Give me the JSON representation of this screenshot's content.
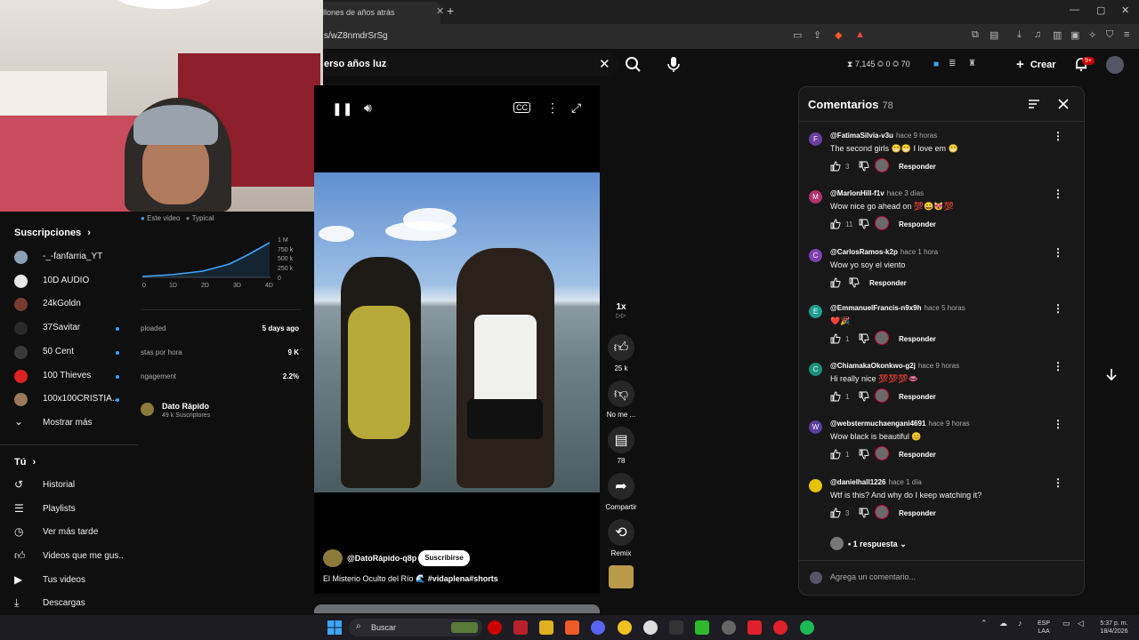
{
  "browser": {
    "tab_title": "llones de años atrás",
    "url": "s/wZ8nmdrSrSg"
  },
  "header": {
    "search_value": "erso años luz",
    "stats": "⧗ 7,145  ◎ 0  ◎ 70",
    "create_label": "Crear",
    "notifications_badge": "9+"
  },
  "sidebar": {
    "subscriptions_title": "Suscripciones",
    "subscriptions": [
      {
        "label": "-_-fanfarria_YT",
        "color": "#8aa0b5",
        "dot": false
      },
      {
        "label": "10D AUDIO",
        "color": "#e8e8e8",
        "dot": false
      },
      {
        "label": "24kGoldn",
        "color": "#7a3b30",
        "dot": false
      },
      {
        "label": "37Savitar",
        "color": "#2a2a2a",
        "dot": true
      },
      {
        "label": "50 Cent",
        "color": "#3a3a3a",
        "dot": true
      },
      {
        "label": "100 Thieves",
        "color": "#d22",
        "dot": true
      },
      {
        "label": "100x100CRISTIA...",
        "color": "#9a7a5a",
        "dot": true
      }
    ],
    "show_more": "Mostrar más",
    "you_title": "Tú",
    "you_items": [
      {
        "label": "Historial",
        "icon": "history-icon"
      },
      {
        "label": "Playlists",
        "icon": "playlists-icon"
      },
      {
        "label": "Ver más tarde",
        "icon": "clock-icon"
      },
      {
        "label": "Videos que me gus...",
        "icon": "thumbs-up-icon"
      },
      {
        "label": "Tus videos",
        "icon": "play-square-icon"
      },
      {
        "label": "Descargas",
        "icon": "download-icon"
      }
    ]
  },
  "analytics": {
    "legend_this": "Este video",
    "legend_typical": "Typical",
    "y_ticks": [
      "1 M",
      "750 k",
      "500 k",
      "250 k",
      "0"
    ],
    "x_ticks": [
      "0",
      "1D",
      "2D",
      "3D",
      "4D"
    ],
    "rows": [
      {
        "label": "ploaded",
        "value": "5 days ago"
      },
      {
        "label": "stas por hora",
        "value": "9 K"
      },
      {
        "label": "ngagement",
        "value": "2.2%"
      }
    ],
    "channel_name": "Dato Rápido",
    "channel_subs": "49 k Suscriptores"
  },
  "short": {
    "channel_handle": "@DatoRápido-q8p",
    "subscribe_label": "Suscribirse",
    "title_plain": "El Misterio Oculto del Río 🌊 ",
    "title_tags": "#vidaplena#shorts",
    "speed": "1x"
  },
  "actions": {
    "likes": "25 k",
    "dislike": "No me ...",
    "comments": "78",
    "share": "Compartir",
    "remix": "Remix"
  },
  "comments": {
    "title": "Comentarios",
    "count": "78",
    "reply_label": "Responder",
    "items": [
      {
        "initial": "F",
        "color": "#6b3fa0",
        "user": "@FatimaSilvia-v3u",
        "time": "hace 9 horas",
        "text": "The second girls 😁😁 I love em 😁",
        "likes": "3",
        "creator": true
      },
      {
        "initial": "M",
        "color": "#b0336a",
        "user": "@MarlonHill-f1v",
        "time": "hace 3 días",
        "text": "Wow nice go ahead on 💯😀😻💯",
        "likes": "11",
        "creator": true
      },
      {
        "initial": "C",
        "color": "#7e3fb0",
        "user": "@CarlosRamos-k2p",
        "time": "hace 1 hora",
        "text": "Wow  yo soy el viento",
        "likes": "",
        "creator": false
      },
      {
        "initial": "E",
        "color": "#1f9e8f",
        "user": "@EmmanuelFrancis-n9x9h",
        "time": "hace 5 horas",
        "text": "❤️🎉",
        "likes": "1",
        "creator": true
      },
      {
        "initial": "C",
        "color": "#1b8f7a",
        "user": "@ChiamakaOkonkwo-g2j",
        "time": "hace 9 horas",
        "text": "Hi really nice 💯💯💯👄",
        "likes": "1",
        "creator": true
      },
      {
        "initial": "W",
        "color": "#5a3fa0",
        "user": "@webstermuchaenganì4691",
        "time": "hace 9 horas",
        "text": "Wow black is beautiful 😊",
        "likes": "1",
        "creator": true
      },
      {
        "initial": "",
        "color": "#e6c200",
        "user": "@danielhall1226",
        "time": "hace 1 día",
        "text": "Wtf is this? And why do I keep watching it?",
        "likes": "3",
        "creator": true
      }
    ],
    "replies_label": "1 respuesta",
    "add_placeholder": "Agrega un comentario..."
  },
  "taskbar": {
    "search_label": "Buscar",
    "lang": "ESP\nLAA",
    "time": "5:37 p. m.",
    "date": "18/4/2026"
  }
}
